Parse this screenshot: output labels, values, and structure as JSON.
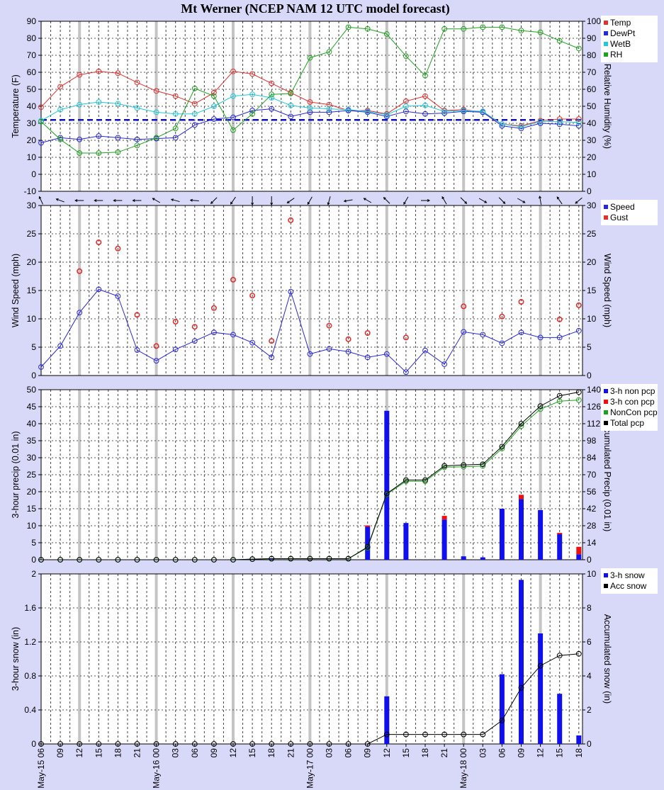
{
  "title": "Mt Werner (NCEP NAM 12 UTC model forecast)",
  "x_tick_labels": [
    "May-15 06",
    "09",
    "12",
    "15",
    "18",
    "21",
    "May-16 00",
    "03",
    "06",
    "09",
    "12",
    "15",
    "18",
    "21",
    "May-17 00",
    "03",
    "06",
    "09",
    "12",
    "15",
    "18",
    "21",
    "May-18 00",
    "03",
    "06",
    "09",
    "12",
    "15",
    "18"
  ],
  "chart_data": [
    {
      "type": "line",
      "ylabel_left": "Temperature (F)",
      "ylabel_right": "Relative Humidity (%)",
      "ylim_left": [
        -10,
        90
      ],
      "ylim_right": [
        0,
        100
      ],
      "yticks_left": [
        -10,
        0,
        10,
        20,
        30,
        40,
        50,
        60,
        70,
        80,
        90
      ],
      "yticks_right": [
        0,
        10,
        20,
        30,
        40,
        50,
        60,
        70,
        80,
        90,
        100
      ],
      "freezing_line": 32,
      "legend": [
        "Temp",
        "DewPt",
        "WetB",
        "RH"
      ],
      "series": [
        {
          "name": "Temp",
          "color": "#e03030",
          "axis": "left",
          "values": [
            39.5,
            51.5,
            58.5,
            60.5,
            59.5,
            54,
            49,
            46,
            41.5,
            48,
            60.5,
            59,
            53.5,
            48,
            42.5,
            41,
            37.5,
            37.5,
            35.5,
            43,
            46,
            37.5,
            38,
            36.5,
            29.5,
            28.5,
            31.5,
            32.5,
            32.5
          ]
        },
        {
          "name": "DewPt",
          "color": "#2828d8",
          "axis": "left",
          "values": [
            18.5,
            21.5,
            20.5,
            22.5,
            21.5,
            20.5,
            21,
            21.5,
            29,
            32.5,
            33.5,
            37.5,
            38.5,
            34,
            36.5,
            36.5,
            37.5,
            36.5,
            34,
            37,
            35.5,
            36,
            37,
            36.5,
            28.5,
            27,
            30,
            29.5,
            28.5
          ]
        },
        {
          "name": "WetB",
          "color": "#20c8d8",
          "axis": "left",
          "values": [
            31.5,
            38,
            41,
            42.5,
            41.5,
            39,
            36.5,
            35.5,
            35.5,
            40,
            46,
            47,
            45,
            40.5,
            39,
            38.5,
            38,
            37,
            35,
            40,
            40.5,
            37,
            37.5,
            37,
            29.5,
            28,
            31,
            31,
            30.5
          ]
        },
        {
          "name": "RH",
          "color": "#20a020",
          "axis": "right",
          "values": [
            41,
            30.5,
            22.5,
            22.5,
            23,
            27,
            31.5,
            37,
            60.5,
            56,
            36,
            45.5,
            57,
            57.5,
            78.5,
            82,
            96.5,
            95.5,
            92.5,
            79.5,
            68,
            95.5,
            95.5,
            96.5,
            96.5,
            94.5,
            93.5,
            88.5,
            84
          ]
        }
      ]
    },
    {
      "type": "line",
      "ylabel_left": "Wind Speed (mph)",
      "ylabel_right": "Wind Speed (mph)",
      "ylim": [
        0,
        30
      ],
      "yticks": [
        0,
        5,
        10,
        15,
        20,
        25,
        30
      ],
      "legend": [
        "Speed",
        "Gust"
      ],
      "wind_direction_arrows_deg": [
        335,
        290,
        270,
        270,
        270,
        270,
        300,
        285,
        275,
        225,
        215,
        180,
        180,
        235,
        210,
        195,
        260,
        300,
        315,
        210,
        90,
        330,
        135,
        120,
        135,
        120,
        350,
        325,
        230
      ],
      "series": [
        {
          "name": "Speed",
          "color": "#2828d8",
          "values": [
            1.5,
            5.2,
            11.1,
            15.2,
            14,
            4.5,
            2.6,
            4.6,
            6.1,
            7.6,
            7.2,
            5.8,
            3.2,
            14.8,
            3.8,
            4.7,
            4.2,
            3.2,
            3.8,
            0.6,
            4.4,
            2,
            7.7,
            7.2,
            5.7,
            7.6,
            6.7,
            6.7,
            7.9
          ]
        },
        {
          "name": "Gust",
          "color": "#e03030",
          "values": [
            null,
            null,
            18.4,
            23.5,
            22.4,
            10.7,
            5.2,
            9.5,
            8.6,
            11.9,
            16.9,
            14.1,
            6.1,
            27.4,
            null,
            8.8,
            6.4,
            7.5,
            null,
            6.7,
            null,
            null,
            12.2,
            null,
            10.4,
            13,
            null,
            9.9,
            12.4
          ]
        }
      ]
    },
    {
      "type": "bar",
      "ylabel_left": "3-hour precip (0.01 in)",
      "ylabel_right": "Accumulated Precip (0.01 in)",
      "ylim_left": [
        0,
        50
      ],
      "ylim_right": [
        0,
        140
      ],
      "yticks_left": [
        0,
        5,
        10,
        15,
        20,
        25,
        30,
        35,
        40,
        45,
        50
      ],
      "yticks_right": [
        0,
        14,
        28,
        42,
        56,
        70,
        84,
        98,
        112,
        126,
        140
      ],
      "legend": [
        "3-h non pcp",
        "3-h con pcp",
        "NonCon pcp",
        "Total pcp"
      ],
      "series": [
        {
          "name": "3-h non pcp",
          "color": "#1010ee",
          "values": [
            0,
            0,
            0,
            0,
            0,
            0,
            0,
            0,
            0,
            0,
            0,
            0.2,
            0.2,
            0,
            0,
            0,
            0,
            9.7,
            43.8,
            10.8,
            0,
            11.8,
            1,
            0.7,
            15,
            17.8,
            14.6,
            7.5,
            1.6
          ]
        },
        {
          "name": "3-h con pcp",
          "color": "#ee1010",
          "values": [
            0,
            0,
            0,
            0,
            0,
            0,
            0,
            0,
            0,
            0,
            0,
            0,
            0,
            0,
            0,
            0,
            0,
            0.4,
            0,
            0,
            0,
            1.1,
            0,
            0,
            0,
            1.3,
            0,
            0.4,
            2.2
          ]
        },
        {
          "name": "NonCon pcp",
          "color": "#20a020",
          "axis": "right",
          "values": [
            0,
            0,
            0,
            0,
            0,
            0,
            0,
            0,
            0,
            0,
            0,
            0.5,
            0.8,
            0.8,
            0.8,
            0.8,
            0.8,
            9.9,
            53.9,
            64.6,
            64.6,
            76.2,
            76.6,
            77.2,
            91.5,
            110,
            124,
            130.5,
            131.5
          ]
        },
        {
          "name": "Total pcp",
          "color": "#000000",
          "axis": "right",
          "values": [
            0,
            0,
            0,
            0,
            0,
            0,
            0,
            0,
            0,
            0,
            0,
            0.5,
            0.9,
            0.9,
            0.9,
            0.9,
            0.9,
            10.5,
            54.4,
            65.6,
            65.6,
            77.3,
            78,
            78.6,
            93.2,
            112,
            126.5,
            135,
            138
          ]
        }
      ]
    },
    {
      "type": "bar",
      "ylabel_left": "3-hour snow (in)",
      "ylabel_right": "Accumulated snow (in)",
      "ylim_left": [
        0,
        2
      ],
      "ylim_right": [
        0,
        10
      ],
      "yticks_left": [
        "0",
        "0.4",
        "0.8",
        "1.2",
        "1.6",
        "2"
      ],
      "yticks_right": [
        "0",
        "2",
        "4",
        "6",
        "8",
        "10"
      ],
      "legend": [
        "3-h snow",
        "Acc snow"
      ],
      "series": [
        {
          "name": "3-h snow",
          "color": "#1010ee",
          "values": [
            0,
            0,
            0,
            0,
            0,
            0,
            0,
            0,
            0,
            0,
            0,
            0,
            0,
            0,
            0,
            0,
            0,
            0,
            0.56,
            0,
            0,
            0,
            0,
            0,
            0.82,
            1.93,
            1.3,
            0.59,
            0.1
          ]
        },
        {
          "name": "Acc snow",
          "color": "#000000",
          "axis": "right",
          "values": [
            0,
            0,
            0,
            0,
            0,
            0,
            0,
            0,
            0,
            0,
            0,
            0,
            0,
            0,
            0,
            0,
            0,
            0,
            0.56,
            0.56,
            0.56,
            0.56,
            0.56,
            0.56,
            1.38,
            3.3,
            4.6,
            5.2,
            5.3
          ]
        }
      ]
    }
  ]
}
